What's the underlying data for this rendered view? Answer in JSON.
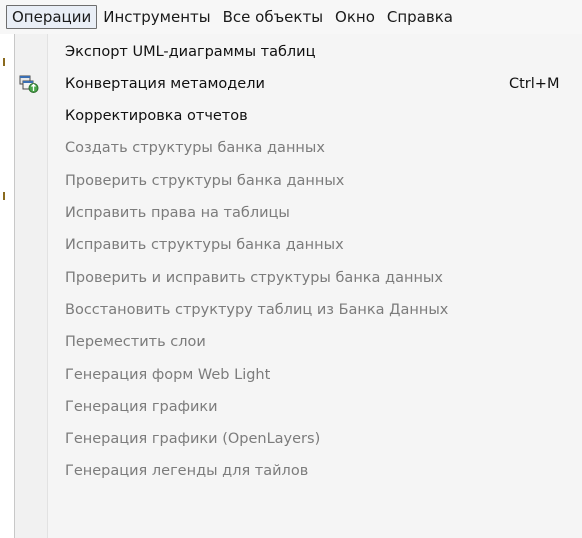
{
  "menubar": {
    "items": [
      {
        "label": "Операции",
        "active": true
      },
      {
        "label": "Инструменты",
        "active": false
      },
      {
        "label": "Все объекты",
        "active": false
      },
      {
        "label": "Окно",
        "active": false
      },
      {
        "label": "Справка",
        "active": false
      }
    ]
  },
  "menu": {
    "items": [
      {
        "label": "Экспорт UML-диаграммы таблиц",
        "enabled": true,
        "shortcut": "",
        "icon": ""
      },
      {
        "label": "Конвертация метамодели",
        "enabled": true,
        "shortcut": "Ctrl+M",
        "icon": "convert-metamodel-icon"
      },
      {
        "label": "Корректировка отчетов",
        "enabled": true,
        "shortcut": "",
        "icon": ""
      },
      {
        "label": "Создать структуры банка данных",
        "enabled": false,
        "shortcut": "",
        "icon": ""
      },
      {
        "label": "Проверить структуры банка данных",
        "enabled": false,
        "shortcut": "",
        "icon": ""
      },
      {
        "label": "Исправить права на таблицы",
        "enabled": false,
        "shortcut": "",
        "icon": ""
      },
      {
        "label": "Исправить структуры банка данных",
        "enabled": false,
        "shortcut": "",
        "icon": ""
      },
      {
        "label": "Проверить и исправить структуры банка данных",
        "enabled": false,
        "shortcut": "",
        "icon": ""
      },
      {
        "label": "Восстановить структуру таблиц из Банка Данных",
        "enabled": false,
        "shortcut": "",
        "icon": ""
      },
      {
        "label": "Переместить слои",
        "enabled": false,
        "shortcut": "",
        "icon": ""
      },
      {
        "label": "Генерация форм Web Light",
        "enabled": false,
        "shortcut": "",
        "icon": ""
      },
      {
        "label": "Генерация графики",
        "enabled": false,
        "shortcut": "",
        "icon": ""
      },
      {
        "label": "Генерация графики (OpenLayers)",
        "enabled": false,
        "shortcut": "",
        "icon": ""
      },
      {
        "label": "Генерация легенды для тайлов",
        "enabled": false,
        "shortcut": "",
        "icon": ""
      }
    ]
  }
}
